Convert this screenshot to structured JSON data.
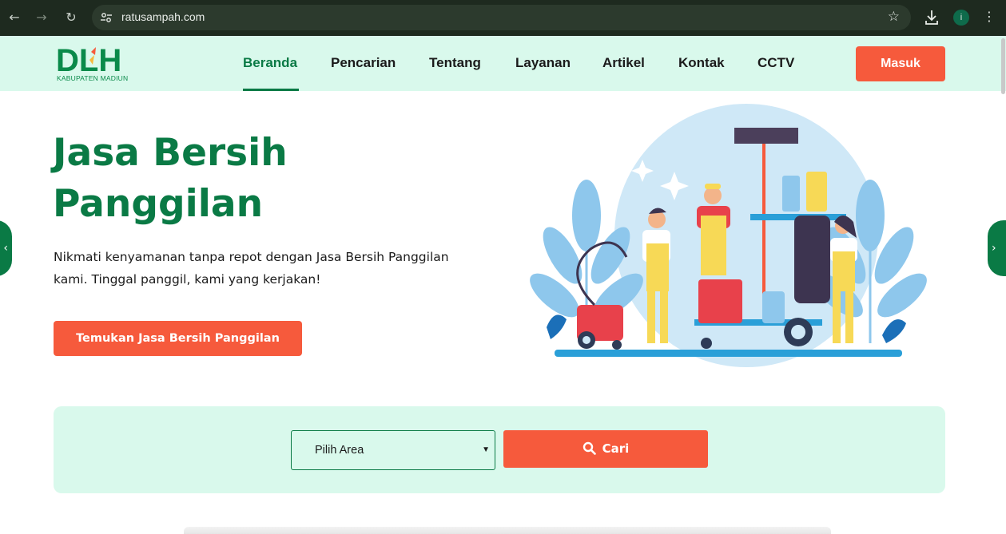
{
  "browser": {
    "url": "ratusampah.com",
    "icons": {
      "back": "back-arrow-icon",
      "forward": "forward-arrow-icon",
      "reload": "reload-icon",
      "site_info": "tune-icon",
      "bookmark": "star-icon",
      "download": "download-icon",
      "menu": "kebab-icon"
    },
    "profile_initial": "i"
  },
  "logo": {
    "mark": "DLH",
    "subtitle": "KABUPATEN MADIUN"
  },
  "nav": {
    "items": [
      {
        "label": "Beranda",
        "active": true
      },
      {
        "label": "Pencarian",
        "active": false
      },
      {
        "label": "Tentang",
        "active": false
      },
      {
        "label": "Layanan",
        "active": false
      },
      {
        "label": "Artikel",
        "active": false
      },
      {
        "label": "Kontak",
        "active": false
      },
      {
        "label": "CCTV",
        "active": false
      }
    ],
    "login_label": "Masuk"
  },
  "hero": {
    "title": "Jasa Bersih Panggilan",
    "description": "Nikmati kenyamanan tanpa repot dengan Jasa Bersih Panggilan kami. Tinggal panggil, kami yang kerjakan!",
    "cta_label": "Temukan Jasa Bersih Panggilan"
  },
  "search": {
    "area_selected": "Pilih Area",
    "button_label": "Cari"
  },
  "colors": {
    "brand_green": "#0a7a45",
    "accent_orange": "#f65a3c",
    "mint_bg": "#d9f9ec"
  }
}
